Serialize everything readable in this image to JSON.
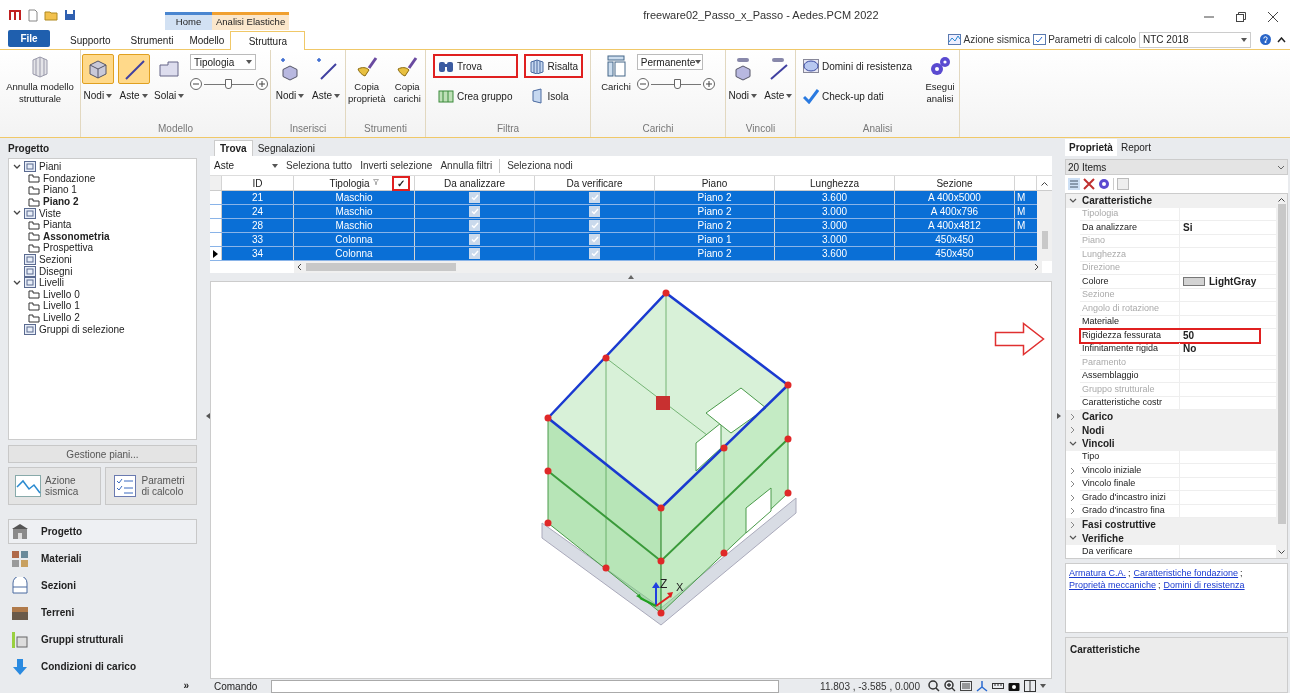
{
  "title_bar": {
    "title": "freeware02_Passo_x_Passo - Aedes.PCM 2022",
    "context_tabs": [
      {
        "label": "Home",
        "color": "#4a86d0"
      },
      {
        "label": "Analisi Elastiche",
        "color": "#f0a030"
      }
    ]
  },
  "ribbon_tabs": [
    {
      "label": "File",
      "kind": "file",
      "selected": false
    },
    {
      "label": "Supporto",
      "kind": "tab",
      "selected": false
    },
    {
      "label": "Strumenti",
      "kind": "tab",
      "selected": false
    },
    {
      "label": "Modello",
      "kind": "tab",
      "selected": false
    },
    {
      "label": "Struttura",
      "kind": "tab",
      "selected": true
    }
  ],
  "quick_links": [
    {
      "label": "Azione sismica"
    },
    {
      "label": "Parametri di calcolo"
    }
  ],
  "standard_select": {
    "value": "NTC 2018"
  },
  "ribbon_groups": [
    {
      "items": [
        {
          "kind": "large",
          "label": "Annulla modello strutturale"
        }
      ]
    },
    {
      "label": "Modello",
      "items": [
        {
          "kind": "toggle",
          "label": "Nodi",
          "selected": true
        },
        {
          "kind": "toggle",
          "label": "Aste",
          "selected": true
        },
        {
          "kind": "toggle",
          "label": "Solai",
          "selected": false
        },
        {
          "kind": "stack",
          "items": [
            {
              "kind": "combo",
              "value": "Tipologia"
            },
            {
              "kind": "slider",
              "level": 0.5
            }
          ]
        }
      ]
    },
    {
      "label": "Inserisci",
      "items": [
        {
          "kind": "toggle",
          "label": "Nodi",
          "selected": false
        },
        {
          "kind": "toggle",
          "label": "Aste",
          "selected": false
        }
      ]
    },
    {
      "label": "Strumenti",
      "items": [
        {
          "kind": "large",
          "label": "Copia proprietà"
        },
        {
          "kind": "large",
          "label": "Copia carichi"
        }
      ]
    },
    {
      "label": "Filtra",
      "items": [
        {
          "kind": "stack",
          "items": [
            {
              "kind": "small",
              "label": "Trova",
              "highlighted": true
            },
            {
              "kind": "small",
              "label": "Crea gruppo",
              "highlighted": false
            }
          ]
        },
        {
          "kind": "stack",
          "items": [
            {
              "kind": "small",
              "label": "Risalta",
              "highlighted": true
            },
            {
              "kind": "small",
              "label": "Isola",
              "highlighted": false
            }
          ]
        }
      ]
    },
    {
      "label": "Carichi",
      "items": [
        {
          "kind": "large",
          "label": "Carichi"
        },
        {
          "kind": "stack",
          "items": [
            {
              "kind": "combo",
              "value": "Permanente"
            },
            {
              "kind": "slider",
              "level": 0.55
            }
          ]
        }
      ]
    },
    {
      "label": "Vincoli",
      "items": [
        {
          "kind": "toggle",
          "label": "Nodi",
          "selected": false
        },
        {
          "kind": "toggle",
          "label": "Aste",
          "selected": false
        }
      ]
    },
    {
      "label": "Analisi",
      "items": [
        {
          "kind": "stack",
          "items": [
            {
              "kind": "small",
              "label": "Domini di resistenza",
              "highlighted": false
            },
            {
              "kind": "small",
              "label": "Check-up dati",
              "highlighted": false
            }
          ]
        },
        {
          "kind": "large",
          "label": "Esegui analisi"
        }
      ]
    }
  ],
  "project_panel": {
    "title": "Progetto",
    "tree": [
      {
        "label": "Piani",
        "active": false,
        "expanded": true,
        "children": [
          {
            "label": "Fondazione",
            "active": false
          },
          {
            "label": "Piano 1",
            "active": false
          },
          {
            "label": "Piano 2",
            "active": true
          }
        ]
      },
      {
        "label": "Viste",
        "active": false,
        "expanded": true,
        "children": [
          {
            "label": "Pianta",
            "active": false
          },
          {
            "label": "Assonometria",
            "active": true
          },
          {
            "label": "Prospettiva",
            "active": false
          }
        ]
      },
      {
        "label": "Sezioni",
        "active": false
      },
      {
        "label": "Disegni",
        "active": false
      },
      {
        "label": "Livelli",
        "active": false,
        "expanded": true,
        "children": [
          {
            "label": "Livello 0",
            "active": false
          },
          {
            "label": "Livello 1",
            "active": false
          },
          {
            "label": "Livello 2",
            "active": false
          }
        ]
      },
      {
        "label": "Gruppi di selezione",
        "active": false
      }
    ],
    "manage_button": "Gestione piani...",
    "action_buttons": [
      {
        "label": "Azione sismica"
      },
      {
        "label": "Parametri di calcolo"
      }
    ],
    "navigation": [
      {
        "label": "Progetto",
        "selected": true
      },
      {
        "label": "Materiali",
        "selected": false
      },
      {
        "label": "Sezioni",
        "selected": false
      },
      {
        "label": "Terreni",
        "selected": false
      },
      {
        "label": "Gruppi strutturali",
        "selected": false
      },
      {
        "label": "Condizioni di carico",
        "selected": false
      }
    ],
    "more": "»"
  },
  "find_panel": {
    "tabs": [
      {
        "label": "Trova",
        "selected": true
      },
      {
        "label": "Segnalazioni",
        "selected": false
      }
    ],
    "filter": {
      "value": "Aste"
    },
    "actions": [
      "Seleziona tutto",
      "Inverti selezione",
      "Annulla filtri",
      "Seleziona nodi"
    ],
    "table": {
      "columns": [
        "ID",
        "Tipologia",
        "Da analizzare",
        "Da verificare",
        "Piano",
        "Lunghezza",
        "Sezione"
      ],
      "filter_check": {
        "label": "✓",
        "highlighted": true
      },
      "rows": [
        {
          "id": "21",
          "tipologia": "Maschio",
          "da_analizzare": true,
          "da_verificare": true,
          "piano": "Piano 2",
          "lunghezza": "3.600",
          "sezione": "A 400x5000",
          "column_9": "M",
          "selected": true,
          "current": false
        },
        {
          "id": "24",
          "tipologia": "Maschio",
          "da_analizzare": true,
          "da_verificare": true,
          "piano": "Piano 2",
          "lunghezza": "3.000",
          "sezione": "A 400x796",
          "column_9": "M",
          "selected": true,
          "current": false
        },
        {
          "id": "28",
          "tipologia": "Maschio",
          "da_analizzare": true,
          "da_verificare": true,
          "piano": "Piano 2",
          "lunghezza": "3.000",
          "sezione": "A 400x4812",
          "column_9": "M",
          "selected": true,
          "current": false
        },
        {
          "id": "33",
          "tipologia": "Colonna",
          "da_analizzare": true,
          "da_verificare": true,
          "piano": "Piano 1",
          "lunghezza": "3.000",
          "sezione": "450x450",
          "selected": true,
          "current": false
        },
        {
          "id": "34",
          "tipologia": "Colonna",
          "da_analizzare": true,
          "da_verificare": true,
          "piano": "Piano 2",
          "lunghezza": "3.600",
          "sezione": "450x450",
          "selected": true,
          "current": true
        }
      ]
    }
  },
  "viewport": {
    "axis_labels": [
      "Z",
      "X"
    ]
  },
  "command_bar": {
    "label": "Comando",
    "coordinates": "11.803 , -3.585 , 0.000"
  },
  "properties_panel": {
    "tabs": [
      {
        "label": "Proprietà",
        "selected": true
      },
      {
        "label": "Report",
        "selected": false
      }
    ],
    "selection": "20 Items",
    "rows": [
      {
        "kind": "category",
        "label": "Caratteristiche",
        "expanded": true
      },
      {
        "kind": "property",
        "label": "Tipologia",
        "enabled": false
      },
      {
        "kind": "property",
        "label": "Da analizzare",
        "value": "Si",
        "enabled": true
      },
      {
        "kind": "property",
        "label": "Piano",
        "enabled": false
      },
      {
        "kind": "property",
        "label": "Lunghezza",
        "enabled": false
      },
      {
        "kind": "property",
        "label": "Direzione",
        "enabled": false
      },
      {
        "kind": "property",
        "label": "Colore",
        "value": "LightGray",
        "color": "#d3d3d3",
        "enabled": true
      },
      {
        "kind": "property",
        "label": "Sezione",
        "enabled": false
      },
      {
        "kind": "property",
        "label": "Angolo di rotazione",
        "enabled": false
      },
      {
        "kind": "property",
        "label": "Materiale",
        "enabled": true
      },
      {
        "kind": "property",
        "label": "Rigidezza fessurata",
        "value": "50",
        "enabled": true,
        "highlighted": true
      },
      {
        "kind": "property",
        "label": "Infinitamente rigida",
        "value": "No",
        "enabled": true
      },
      {
        "kind": "property",
        "label": "Paramento",
        "enabled": false
      },
      {
        "kind": "property",
        "label": "Assemblaggio",
        "enabled": true
      },
      {
        "kind": "property",
        "label": "Gruppo strutturale",
        "enabled": false
      },
      {
        "kind": "property",
        "label": "Caratteristiche costr",
        "enabled": true
      },
      {
        "kind": "category",
        "label": "Carico",
        "expanded": false
      },
      {
        "kind": "category",
        "label": "Nodi",
        "expanded": false
      },
      {
        "kind": "category",
        "label": "Vincoli",
        "expanded": true
      },
      {
        "kind": "property",
        "label": "Tipo",
        "enabled": true
      },
      {
        "kind": "property",
        "label": "Vincolo iniziale",
        "enabled": true,
        "expandable": true
      },
      {
        "kind": "property",
        "label": "Vincolo finale",
        "enabled": true,
        "expandable": true
      },
      {
        "kind": "property",
        "label": "Grado d'incastro inizi",
        "enabled": true,
        "expandable": true
      },
      {
        "kind": "property",
        "label": "Grado d'incastro fina",
        "enabled": true,
        "expandable": true
      },
      {
        "kind": "category",
        "label": "Fasi costruttive",
        "expanded": false
      },
      {
        "kind": "category",
        "label": "Verifiche",
        "expanded": true
      },
      {
        "kind": "property",
        "label": "Da verificare",
        "enabled": true
      }
    ],
    "links": [
      {
        "label": "Armatura C.A.",
        "suffix": ";"
      },
      {
        "label": "Caratteristiche fondazione",
        "suffix": ";"
      },
      {
        "label": "Proprietà meccaniche",
        "suffix": ";"
      },
      {
        "label": "Domini di resistenza"
      }
    ],
    "description": "Caratteristiche"
  }
}
